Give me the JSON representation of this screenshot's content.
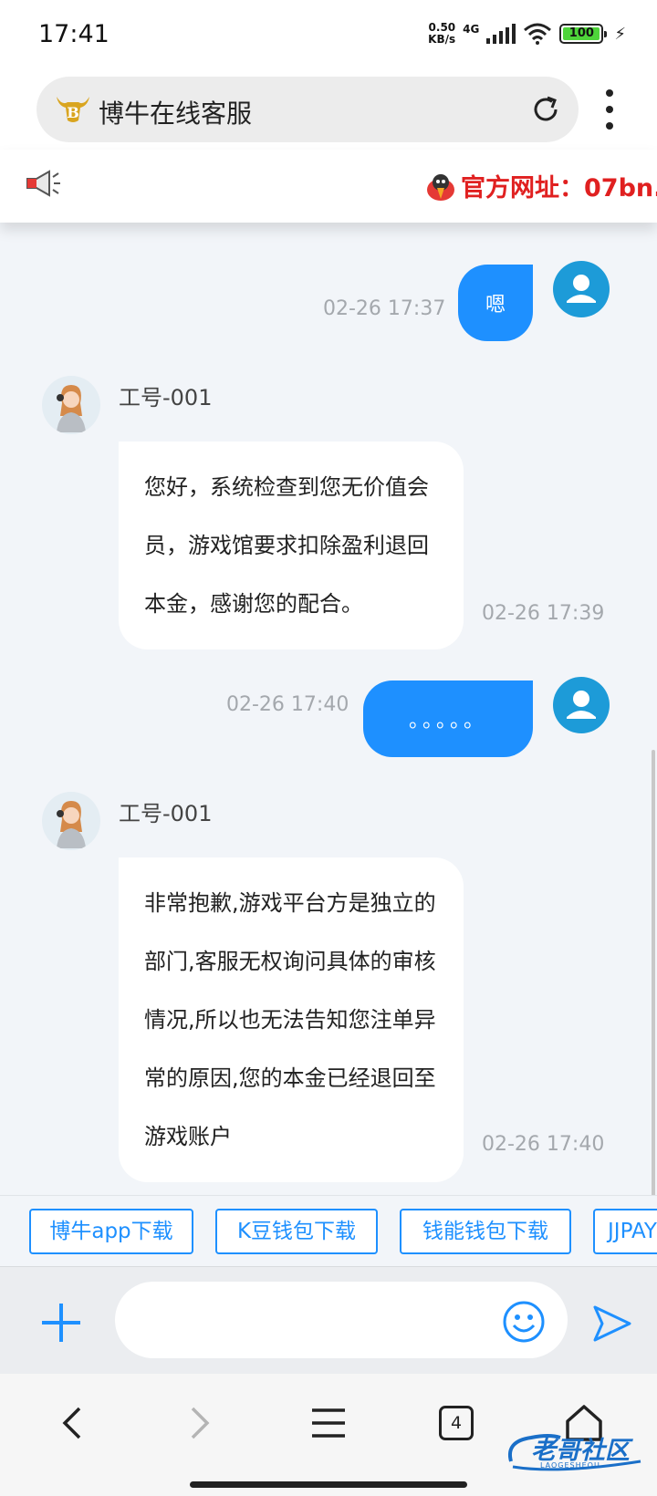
{
  "status_bar": {
    "time": "17:41",
    "net_speed_value": "0.50",
    "net_speed_unit": "KB/s",
    "network": "4G",
    "battery": "100"
  },
  "browser": {
    "title": "博牛在线客服",
    "tab_count": "4"
  },
  "marquee": {
    "text": "官方网址：07bn."
  },
  "messages": [
    {
      "sender": "user",
      "text": "嗯",
      "time": "02-26 17:37"
    },
    {
      "sender": "agent",
      "agent_name": "工号-001",
      "text": "您好，系统检查到您无价值会员，游戏馆要求扣除盈利退回本金，感谢您的配合。",
      "time": "02-26 17:39"
    },
    {
      "sender": "user",
      "text": "。。。。。",
      "time": "02-26 17:40"
    },
    {
      "sender": "agent",
      "agent_name": "工号-001",
      "text": "非常抱歉,游戏平台方是独立的部门,客服无权询问具体的审核情况,所以也无法告知您注单异常的原因,您的本金已经退回至游戏账户",
      "time": "02-26 17:40"
    }
  ],
  "quick_links": [
    {
      "label": "博牛app下载"
    },
    {
      "label": "K豆钱包下载"
    },
    {
      "label": "钱能钱包下载"
    },
    {
      "label": "JJPAY"
    }
  ],
  "input": {
    "value": "",
    "placeholder": ""
  },
  "watermark": {
    "text": "老哥社区",
    "sub": "LAOGESHEQU"
  },
  "colors": {
    "accent": "#1e90ff",
    "user_avatar": "#1d9bd8",
    "chat_bg": "#f2f5f9",
    "marquee_text": "#e02020",
    "battery_fill": "#4ed43a"
  },
  "icons": {
    "status": [
      "signal-icon",
      "wifi-icon",
      "battery-icon",
      "charging-icon"
    ],
    "browser": [
      "site-logo-icon",
      "reload-icon",
      "menu-icon"
    ],
    "marquee": [
      "megaphone-icon",
      "bird-icon"
    ],
    "input": [
      "plus-icon",
      "emoji-icon",
      "send-icon"
    ],
    "nav": [
      "back-icon",
      "forward-icon",
      "hamburger-icon",
      "tabs-icon",
      "home-icon"
    ]
  }
}
